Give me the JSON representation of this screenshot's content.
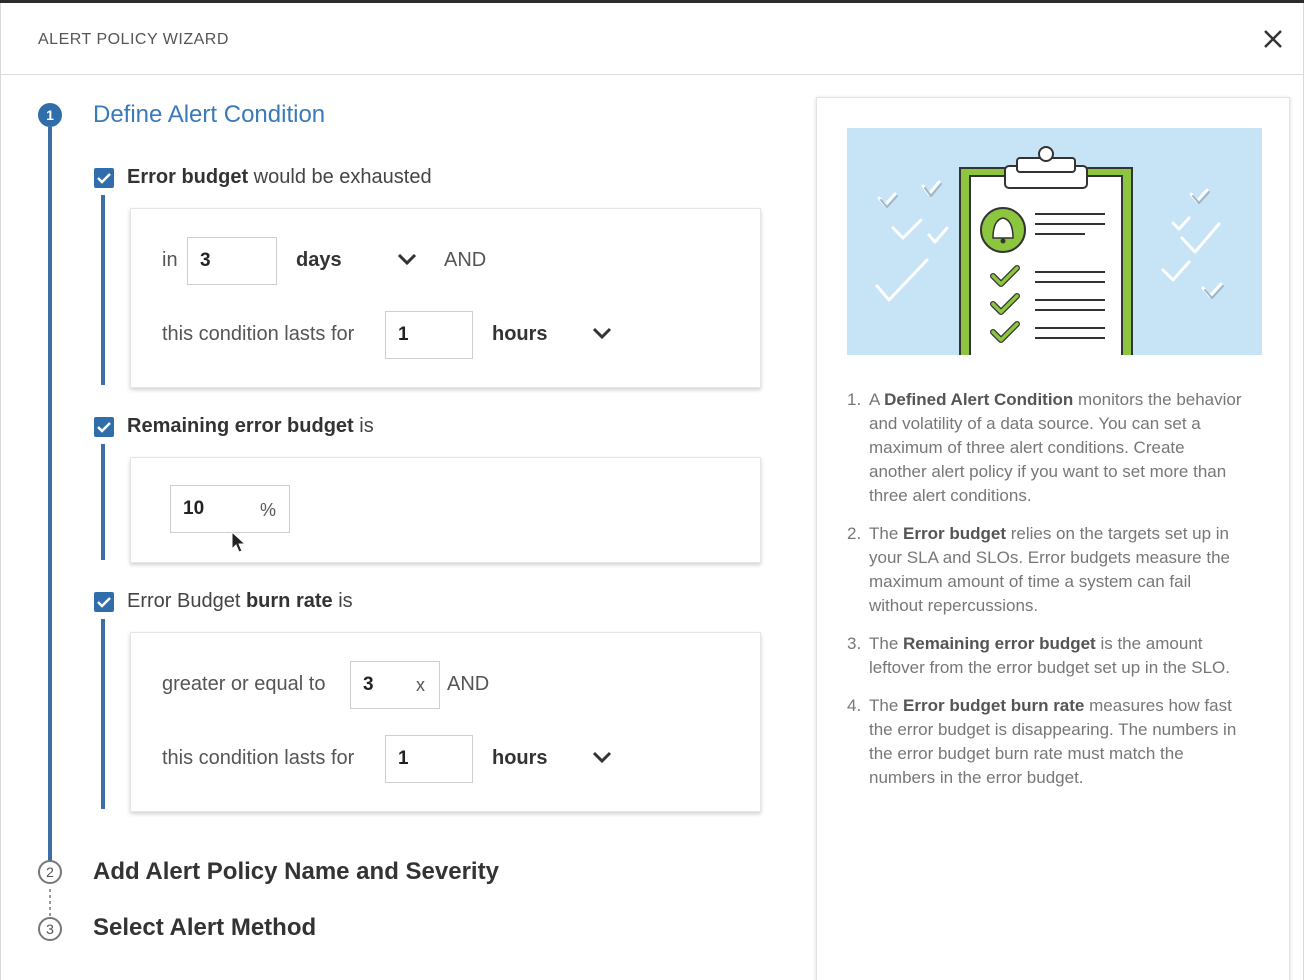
{
  "header": {
    "title": "ALERT POLICY WIZARD",
    "close_icon": "close-icon"
  },
  "steps": [
    {
      "number": "1",
      "title": "Define Alert Condition",
      "state": "active"
    },
    {
      "number": "2",
      "title": "Add Alert Policy Name and Severity",
      "state": "pending"
    },
    {
      "number": "3",
      "title": "Select Alert Method",
      "state": "pending"
    }
  ],
  "conditions": {
    "error_budget": {
      "checked": true,
      "label_bold": "Error budget",
      "label_rest": " would be exhausted",
      "in_label": "in",
      "in_value": "3",
      "in_unit": "days",
      "and_label": "AND",
      "lasts_label": "this condition lasts for",
      "lasts_value": "1",
      "lasts_unit": "hours"
    },
    "remaining": {
      "checked": true,
      "label_bold": "Remaining error budget",
      "label_rest": " is",
      "value": "10",
      "suffix": "%"
    },
    "burn_rate": {
      "checked": true,
      "label_pre": "Error Budget ",
      "label_bold": "burn rate",
      "label_rest": " is",
      "gte_label": "greater or equal to",
      "gte_value": "3",
      "gte_suffix": "x",
      "and_label": "AND",
      "lasts_label": "this condition lasts for",
      "lasts_value": "1",
      "lasts_unit": "hours"
    }
  },
  "help": {
    "notes": [
      {
        "num": "1.",
        "pre": "A ",
        "bold": "Defined Alert Condition",
        "post": " monitors the behavior and volatility of a data source. You can set a maximum of three alert conditions. Create another alert policy if you want to set more than three alert conditions."
      },
      {
        "num": "2.",
        "pre": "The ",
        "bold": "Error budget",
        "post": " relies on the targets set up in your SLA and SLOs. Error budgets measure the maximum amount of time a system can fail without repercussions."
      },
      {
        "num": "3.",
        "pre": "The ",
        "bold": "Remaining error budget",
        "post": " is the amount leftover from the error budget set up in the SLO."
      },
      {
        "num": "4.",
        "pre": "The ",
        "bold": "Error budget burn rate",
        "post": " measures how fast the error budget is disappearing. The numbers in the error budget burn rate must match the numbers in the error budget."
      }
    ]
  },
  "colors": {
    "accent": "#2f6eaa",
    "step_title": "#3a7ab8",
    "illustration_bg": "#c7e3f6",
    "illustration_green": "#8cc63f"
  }
}
